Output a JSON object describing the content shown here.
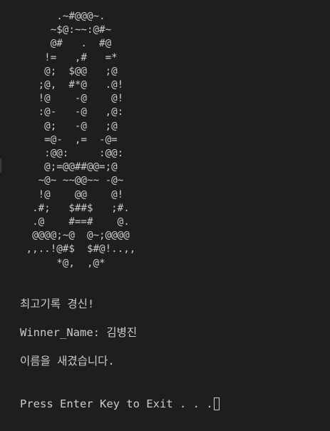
{
  "ascii_art": [
    "      .~#@@@~.",
    "     ~$@:~~:@#~",
    "     @#   .  #@",
    "    !=   ,#   =*",
    "    @;  $@@   ;@",
    "   ;@,  #*@   .@!",
    "   !@    -@    @!",
    "   :@-   -@   ,@:",
    "    @;   -@   ;@",
    "    =@-  ,=  -@=",
    "    :@@:     :@@:",
    "    @;=@@##@@=;@",
    "   ~@~ ~~@@~~ -@~",
    "   !@    @@    @!",
    "  .#;   $##$   ;#.",
    "  .@    #==#    @.",
    "  @@@@;~@  @~;@@@@",
    " ,,..!@#$  $#@!..,,",
    "      *@,  ,@*"
  ],
  "messages": {
    "record": "최고기록 경신!",
    "winner_label": "Winner_Name: ",
    "winner_name": "김병진",
    "saved": "이름을 새겼습니다.",
    "exit_prompt": "Press Enter Key to Exit . . ."
  },
  "colors": {
    "background": "#1e1e1e",
    "text": "#cccccc"
  }
}
